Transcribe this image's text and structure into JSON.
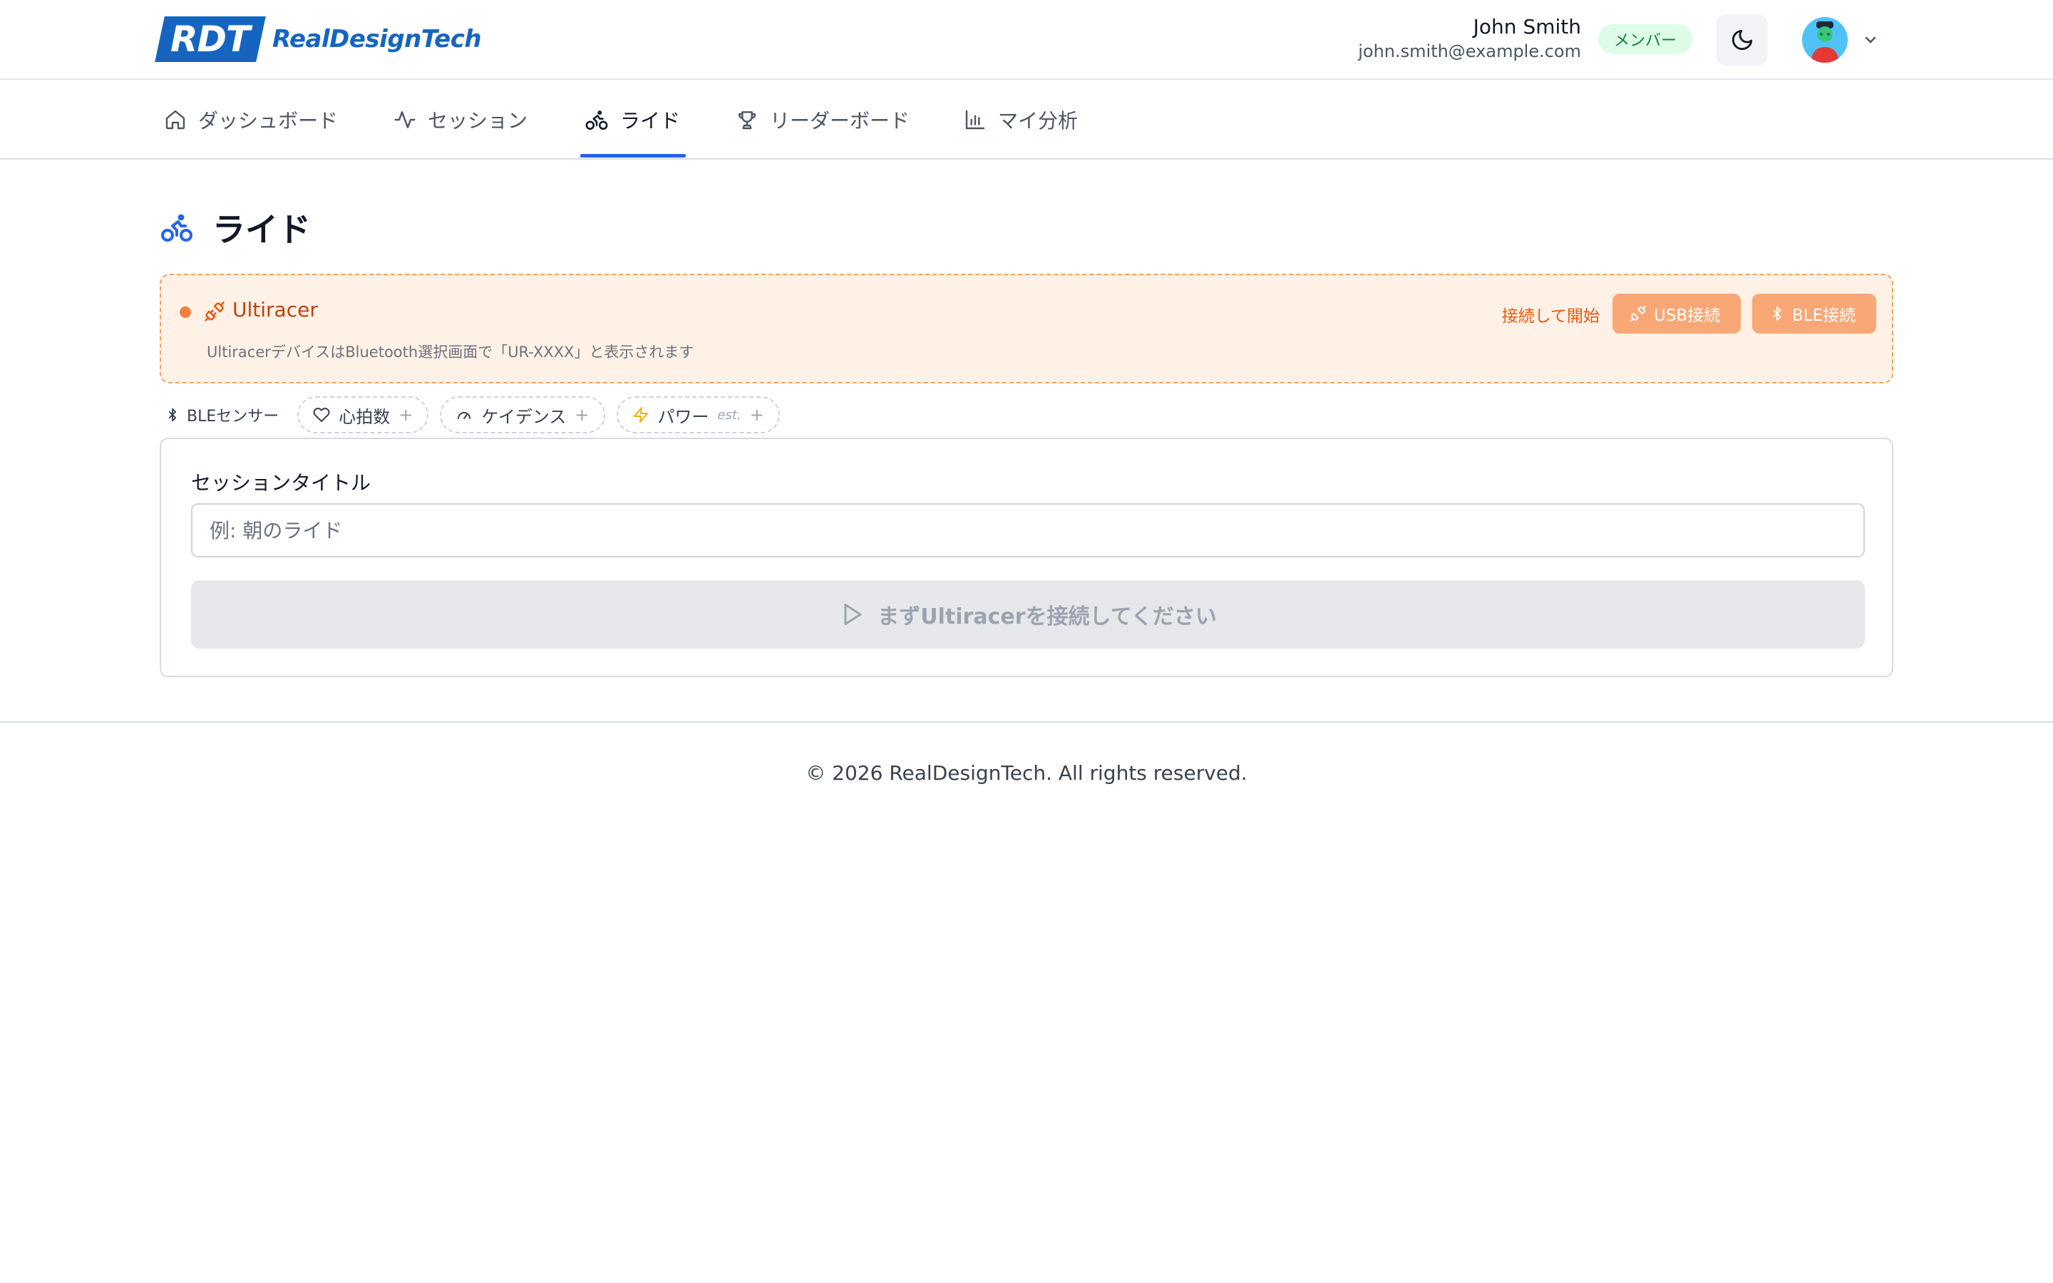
{
  "brand": {
    "logo_mark": "RDT",
    "name": "RealDesignTech",
    "color": "#1565c0"
  },
  "user": {
    "name": "John Smith",
    "email": "john.smith@example.com",
    "role": "メンバー",
    "theme_icon": "moon-icon",
    "avatar_icon": "avatar"
  },
  "nav": {
    "items": [
      {
        "label": "ダッシュボード",
        "icon": "home-icon"
      },
      {
        "label": "セッション",
        "icon": "activity-icon"
      },
      {
        "label": "ライド",
        "icon": "bike-icon",
        "active": true
      },
      {
        "label": "リーダーボード",
        "icon": "trophy-icon"
      },
      {
        "label": "マイ分析",
        "icon": "bar-chart-icon"
      }
    ],
    "accent": "#2563eb"
  },
  "page": {
    "title": "ライド",
    "icon": "bike-icon"
  },
  "device": {
    "name": "Ultiracer",
    "status_color": "#f2803a",
    "hint": "UltiracerデバイスはBluetooth選択画面で「UR-XXXX」と表示されます",
    "connect_label": "接続して開始",
    "usb_button": "USB接続",
    "ble_button": "BLE接続"
  },
  "sensors": {
    "label": "BLEセンサー",
    "chips": [
      {
        "label": "心拍数",
        "icon": "heart-icon"
      },
      {
        "label": "ケイデンス",
        "icon": "gauge-icon"
      },
      {
        "label": "パワー",
        "icon": "bolt-icon",
        "note": "est."
      }
    ]
  },
  "session": {
    "title_label": "セッションタイトル",
    "title_placeholder": "例: 朝のライド",
    "title_value": "",
    "start_button": "まずUltiracerを接続してください"
  },
  "footer": {
    "copyright": "© 2026 RealDesignTech. All rights reserved."
  }
}
